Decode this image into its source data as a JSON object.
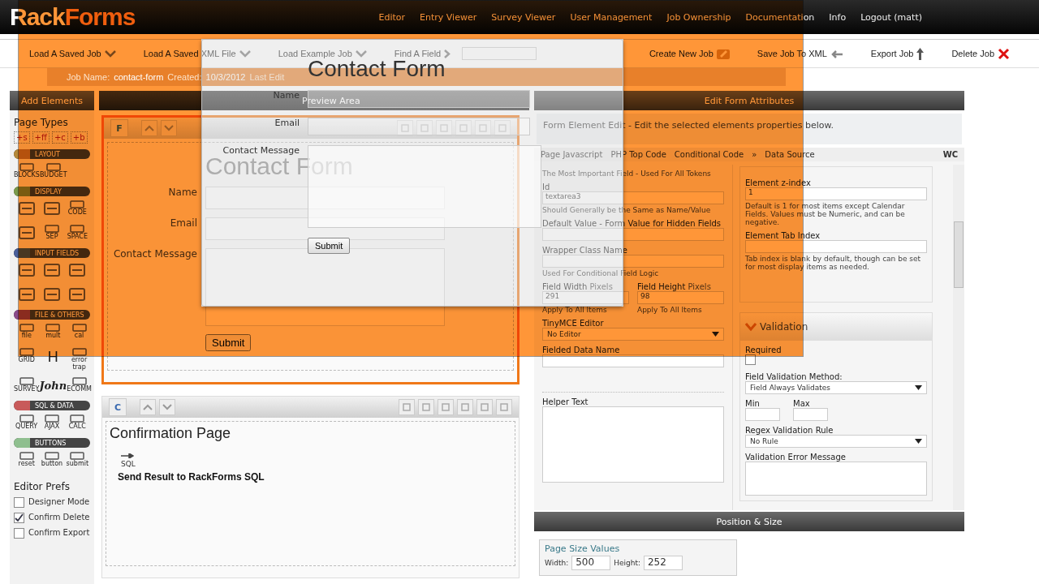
{
  "logo": {
    "part_1": "Rack",
    "part_2": "Forms"
  },
  "nav": [
    "Editor",
    "Entry Viewer",
    "Survey Viewer",
    "User Management",
    "Job Ownership",
    "Documentation",
    "Info",
    "Logout (matt)"
  ],
  "toolbar": [
    {
      "label": "Load A Saved Job",
      "kind": "dropdown"
    },
    {
      "label": "Load A Saved XML File",
      "kind": "dropdown"
    },
    {
      "label": "Load Example Job",
      "kind": "dropdown"
    },
    {
      "label": "Find A Field",
      "kind": "search"
    },
    {
      "label": "Create New Job",
      "kind": "create"
    },
    {
      "label": "Save Job To XML",
      "kind": "save"
    },
    {
      "label": "Export Job",
      "kind": "export"
    },
    {
      "label": "Delete Job",
      "kind": "delete"
    }
  ],
  "job_bar": {
    "name_label": "Job Name:",
    "name": "contact-form",
    "created_label": "Created:",
    "created": "10/3/2012",
    "edited_label": "Last Edit"
  },
  "sidebar": {
    "title": "Add Elements",
    "page_types_title": "Page Types",
    "page_types": [
      "+s",
      "+ff",
      "+c",
      "+b"
    ],
    "groups": [
      {
        "title": "LAYOUT",
        "color": "#b5893a",
        "items": [
          {
            "kind": "tool",
            "label": "BLOCKS"
          },
          {
            "kind": "tool",
            "label": "BUDGET"
          }
        ]
      },
      {
        "title": "DISPLAY",
        "color": "#7a9a4a",
        "items": [
          {
            "kind": "icon"
          },
          {
            "kind": "icon"
          },
          {
            "kind": "tool",
            "label": "CODE"
          },
          {
            "kind": "icon"
          },
          {
            "kind": "tool",
            "label": "SEP"
          },
          {
            "kind": "tool",
            "label": "SPACE"
          }
        ]
      },
      {
        "title": "INPUT FIELDS",
        "color": "#4a5f9a",
        "items": [
          {
            "kind": "icon"
          },
          {
            "kind": "icon"
          },
          {
            "kind": "icon"
          },
          {
            "kind": "icon"
          },
          {
            "kind": "icon"
          },
          {
            "kind": "icon"
          }
        ]
      },
      {
        "title": "FILE & OTHERS",
        "color": "#8a4a8a",
        "items": [
          {
            "kind": "tool",
            "label": "file"
          },
          {
            "kind": "tool",
            "label": "mult"
          },
          {
            "kind": "tool",
            "label": "cal"
          },
          {
            "kind": "tool",
            "label": "GRID"
          },
          {
            "kind": "glyph",
            "label": "H"
          },
          {
            "kind": "tool",
            "label": "error trap"
          },
          {
            "kind": "tool",
            "label": "SURVEY"
          },
          {
            "kind": "signature",
            "label": "John"
          },
          {
            "kind": "tool",
            "label": "ECOMM"
          }
        ]
      },
      {
        "title": "SQL & DATA",
        "color": "#c85a5a",
        "items": [
          {
            "kind": "tool",
            "label": "QUERY"
          },
          {
            "kind": "tool",
            "label": "AJAX"
          },
          {
            "kind": "tool",
            "label": "CALC"
          }
        ]
      },
      {
        "title": "BUTTONS",
        "color": "#8fbf8f",
        "items": [
          {
            "kind": "tool",
            "label": "reset"
          },
          {
            "kind": "tool",
            "label": "button"
          },
          {
            "kind": "tool",
            "label": "submit"
          }
        ]
      }
    ],
    "prefs_title": "Editor Prefs",
    "prefs": [
      {
        "label": "Designer Mode",
        "checked": false
      },
      {
        "label": "Confirm Delete",
        "checked": true
      },
      {
        "label": "Confirm Export",
        "checked": false
      }
    ]
  },
  "preview": {
    "title": "Preview Area",
    "pages": [
      {
        "badge": "F",
        "selected": true,
        "heading": "Contact Form",
        "fields": [
          {
            "label": "Name",
            "kind": "input"
          },
          {
            "label": "Email",
            "kind": "input"
          },
          {
            "label": "Contact Message",
            "kind": "textarea"
          }
        ],
        "button": "Submit"
      },
      {
        "badge": "C",
        "selected": false,
        "heading": "Confirmation Page",
        "sql_label": "SQL",
        "text": "Send Result to RackForms SQL"
      }
    ]
  },
  "attributes": {
    "title": "Edit Form Attributes",
    "description": "Form Element Edit - Edit the selected elements properties below.",
    "tabs": [
      "Page Javascript",
      "PHP Top Code",
      "Conditional Code",
      "»",
      "Data Source",
      "WC"
    ],
    "left": {
      "note": "The Most Important Field - Used For All Tokens",
      "id_label": "Id",
      "id_value": "textarea3",
      "id_hint": "Should Generally be the Same as Name/Value",
      "default_label": "Default Value - Form Value for Hidden Fields",
      "wrapper_label": "Wrapper Class Name",
      "wrapper_hint": "Used For Conditional Field Logic",
      "width_label": "Field Width",
      "width_unit": "Pixels",
      "width_value": "291",
      "apply_width": "Apply To All Items",
      "height_label": "Field Height",
      "height_unit": "Pixels",
      "height_value": "98",
      "apply_height": "Apply To All Items",
      "tinymce_label": "TinyMCE Editor",
      "tinymce_value": "No Editor",
      "fielded_label": "Fielded Data Name",
      "helper_label": "Helper Text"
    },
    "right": {
      "z_label": "Element z-index",
      "z_value": "1",
      "z_hint": "Default is 1 for most items except Calendar Fields. Values must be Numeric, and can be negative.",
      "tab_label": "Element Tab Index",
      "tab_hint": "Tab index is blank by default, though can be set for most display items as needed.",
      "validation_title": "Validation",
      "required_label": "Required",
      "required": false,
      "method_label": "Field Validation Method:",
      "method_value": "Field Always Validates",
      "min_label": "Min",
      "max_label": "Max",
      "regex_label": "Regex Validation Rule",
      "regex_value": "No Rule",
      "error_label": "Validation Error Message"
    },
    "position_title": "Position & Size",
    "size_legend": "Page Size Values",
    "width_label": "Width:",
    "width_value": "500",
    "height_label": "Height:",
    "height_value": "252"
  },
  "dialog": {
    "title": "Contact Form",
    "fields": [
      {
        "label": "Name",
        "kind": "input"
      },
      {
        "label": "Email",
        "kind": "input"
      },
      {
        "label": "Contact Message",
        "kind": "textarea"
      }
    ],
    "button": "Submit"
  }
}
